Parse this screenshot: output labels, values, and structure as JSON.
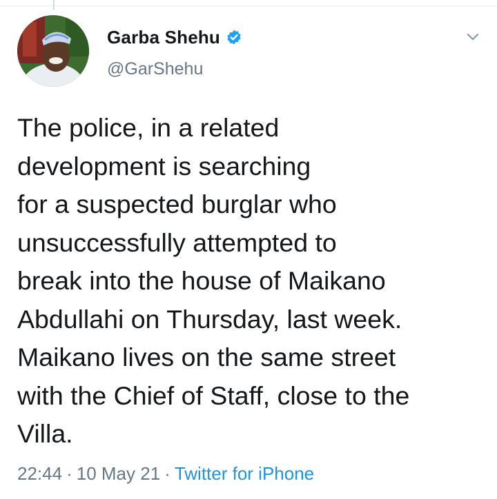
{
  "tweet": {
    "author": {
      "display_name": "Garba Shehu",
      "handle": "@GarShehu",
      "verified": true,
      "avatar_icon": "profile-photo"
    },
    "text": "The police, in a related\ndevelopment is searching\nfor a suspected burglar who\nunsuccessfully attempted to\nbreak into the house of Maikano\nAbdullahi on Thursday, last week.\nMaikano lives on the same street\nwith the Chief of Staff, close to the\nVilla.",
    "time": "22:44",
    "separator": "·",
    "date": "10 May 21",
    "source": "Twitter for iPhone"
  },
  "icons": {
    "verified": "verified-badge-icon",
    "menu": "chevron-down-icon"
  },
  "colors": {
    "text": "#14171a",
    "secondary": "#657786",
    "link": "#1b95e0",
    "verified": "#1da1f2"
  }
}
